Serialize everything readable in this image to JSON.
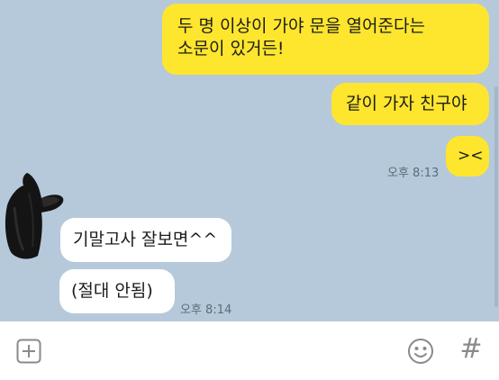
{
  "messages": {
    "out1": {
      "line1": "두 명 이상이 가야 문을 열어준다는",
      "line2": "소문이 있거든!"
    },
    "out2": "같이 가자 친구야",
    "out3": "><",
    "out_time": "오후 8:13",
    "in1": "기말고사 잘보면^^",
    "in2": "(절대 안됨)",
    "in_time": "오후 8:14"
  },
  "input_bar": {
    "plus_icon": "plus-icon",
    "emoji_icon": "emoji-icon",
    "hash_label": "#"
  },
  "colors": {
    "chat_background": "#b5c9db",
    "outgoing_bubble": "#fde62d",
    "incoming_bubble": "#ffffff"
  }
}
